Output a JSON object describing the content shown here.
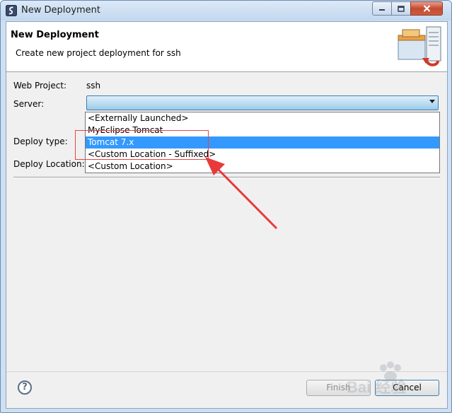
{
  "window": {
    "title": "New Deployment"
  },
  "header": {
    "title": "New Deployment",
    "description": "Create new project deployment for ssh"
  },
  "form": {
    "web_project_label": "Web Project:",
    "web_project_value": "ssh",
    "server_label": "Server:",
    "server_value": "",
    "deploy_type_label": "Deploy type:",
    "deploy_location_label": "Deploy Location:"
  },
  "server_options": [
    {
      "label": "<Externally Launched>",
      "selected": false
    },
    {
      "label": "MyEclipse Tomcat",
      "selected": false
    },
    {
      "label": "Tomcat  7.x",
      "selected": true
    },
    {
      "label": "<Custom Location - Suffixed>",
      "selected": false
    },
    {
      "label": "<Custom Location>",
      "selected": false
    }
  ],
  "buttons": {
    "finish": "Finish",
    "cancel": "Cancel",
    "help": "?"
  },
  "annotation": {
    "highlight_color": "#e84545",
    "arrow_color": "#e83a3a"
  },
  "watermark": {
    "text": "Bai 经验"
  },
  "colors": {
    "selection": "#3399ff",
    "titlebar": "#c2d7ee",
    "close_button": "#c64a32"
  }
}
